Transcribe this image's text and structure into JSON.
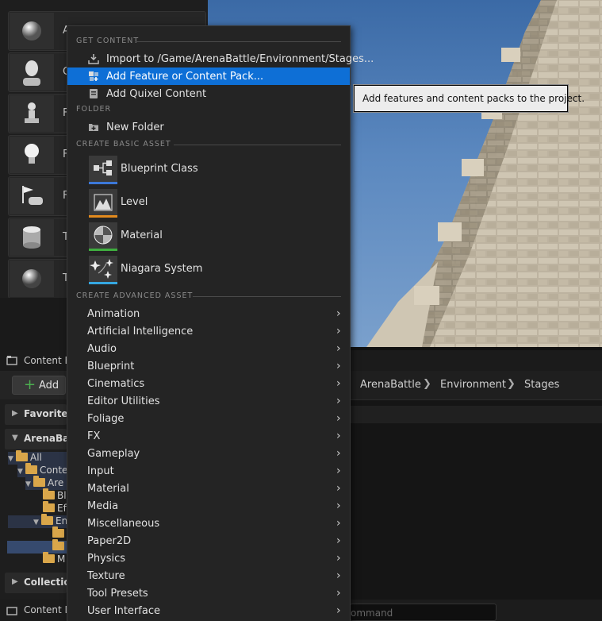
{
  "place_actors": {
    "items": [
      {
        "label": "A",
        "icon": "sphere-icon"
      },
      {
        "label": "C",
        "icon": "character-icon"
      },
      {
        "label": "F",
        "icon": "pawn-icon"
      },
      {
        "label": "F",
        "icon": "light-bulb-icon"
      },
      {
        "label": "F",
        "icon": "game-mode-icon"
      },
      {
        "label": "T",
        "icon": "cylinder-icon"
      },
      {
        "label": "T",
        "icon": "sphere-icon"
      }
    ]
  },
  "content_browser": {
    "title": "Content B",
    "add_label": "Add",
    "breadcrumb": [
      "ArenaBattle",
      "Environment",
      "Stages"
    ],
    "sections": {
      "favorites": "Favorites",
      "project": "ArenaBatt",
      "collections": "Collection"
    },
    "tree": [
      "All",
      "Conte",
      "Are",
      "Bl",
      "Ef",
      "En",
      "",
      "",
      "M"
    ],
    "command_placeholder": "ommand",
    "bottom_tab": "Content D"
  },
  "menu": {
    "headers": {
      "get_content": "GET CONTENT",
      "folder": "FOLDER",
      "basic": "CREATE BASIC ASSET",
      "advanced": "CREATE ADVANCED ASSET"
    },
    "get_content": [
      {
        "label": "Import to /Game/ArenaBattle/Environment/Stages...",
        "icon": "import-icon"
      },
      {
        "label": "Add Feature or Content Pack...",
        "icon": "feature-pack-icon",
        "highlighted": true
      },
      {
        "label": "Add Quixel Content",
        "icon": "quixel-icon"
      }
    ],
    "folder": [
      {
        "label": "New Folder",
        "icon": "new-folder-icon"
      }
    ],
    "basic_assets": [
      {
        "label": "Blueprint Class",
        "icon": "blueprint-class-icon",
        "color": "#3c78d8"
      },
      {
        "label": "Level",
        "icon": "level-icon",
        "color": "#e38a1d"
      },
      {
        "label": "Material",
        "icon": "material-icon",
        "color": "#3fae3f"
      },
      {
        "label": "Niagara System",
        "icon": "niagara-icon",
        "color": "#35a7e0"
      }
    ],
    "advanced": [
      "Animation",
      "Artificial Intelligence",
      "Audio",
      "Blueprint",
      "Cinematics",
      "Editor Utilities",
      "Foliage",
      "FX",
      "Gameplay",
      "Input",
      "Material",
      "Media",
      "Miscellaneous",
      "Paper2D",
      "Physics",
      "Texture",
      "Tool Presets",
      "User Interface"
    ]
  },
  "tooltip": {
    "text": "Add features and content packs to the project."
  },
  "colors": {
    "highlight": "#0e6fd6",
    "menu_bg": "#242424"
  }
}
